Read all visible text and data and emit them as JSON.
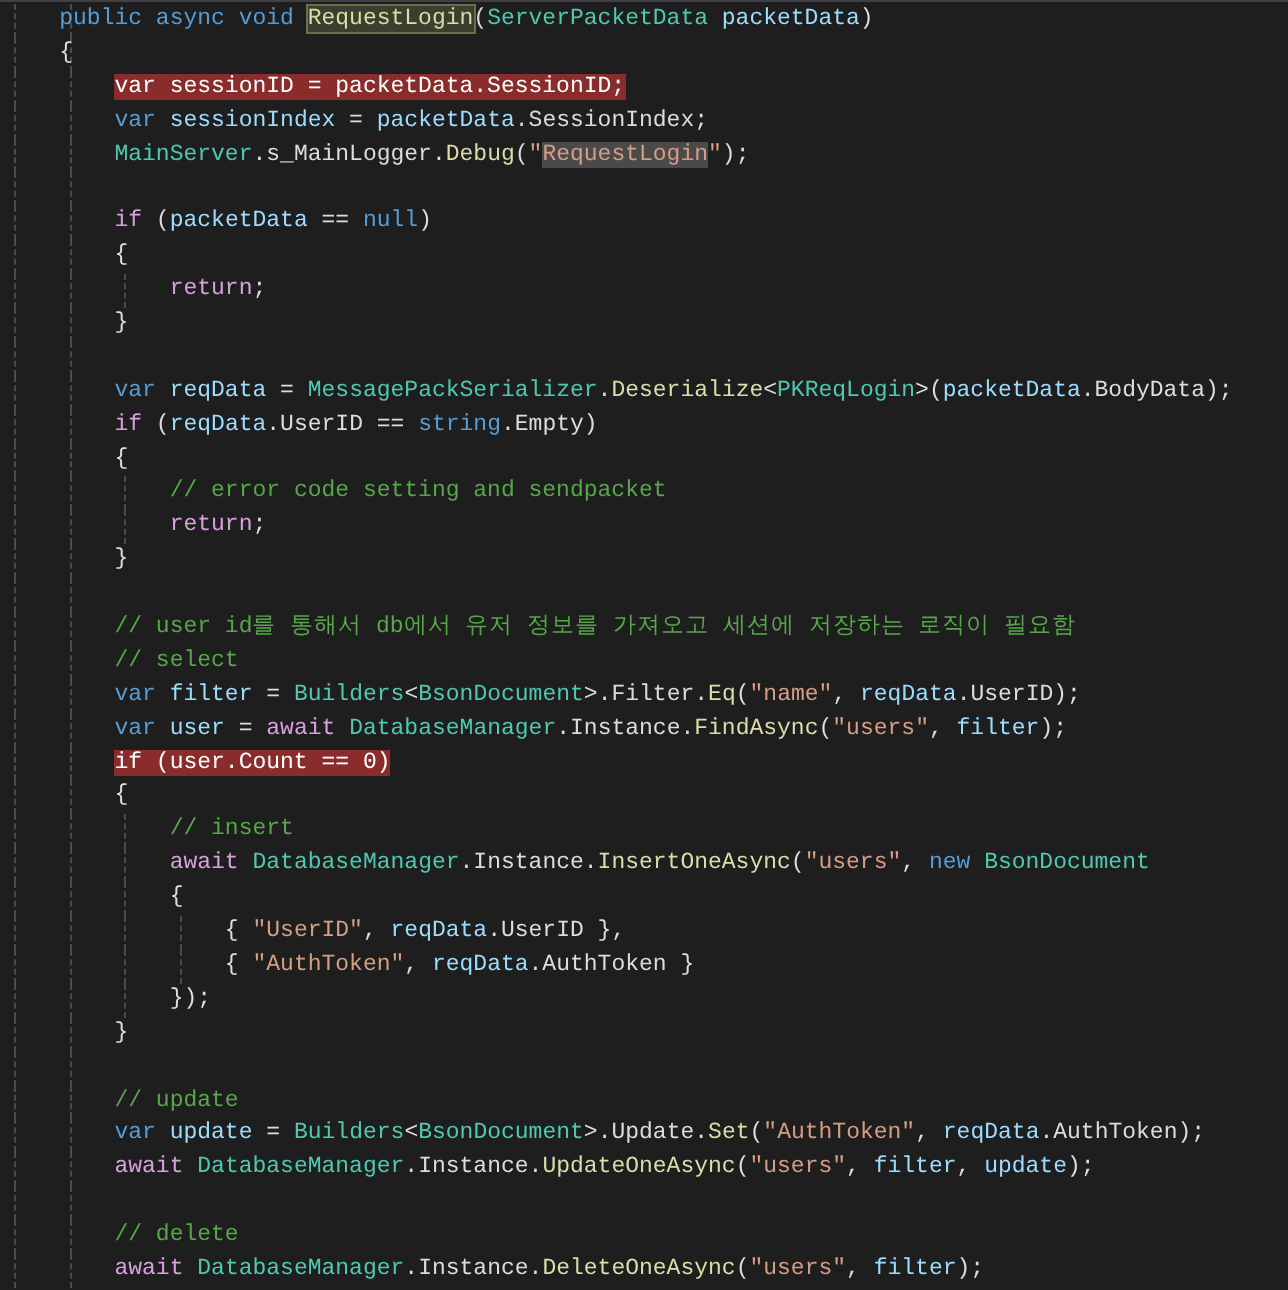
{
  "editor": {
    "lines": [
      {
        "kind": "code",
        "breakpoint": false,
        "tokens": [
          {
            "kind": "keyword",
            "text": "    public async void "
          },
          {
            "kind": "method-reference",
            "text": "RequestLogin"
          },
          {
            "kind": "plain",
            "text": "("
          },
          {
            "kind": "type",
            "text": "ServerPacketData"
          },
          {
            "kind": "variable",
            "text": " packetData"
          },
          {
            "kind": "plain",
            "text": ")"
          }
        ]
      },
      {
        "kind": "code",
        "breakpoint": false,
        "tokens": [
          {
            "kind": "plain",
            "text": "    {"
          }
        ]
      },
      {
        "kind": "code",
        "breakpoint": true,
        "tokens": [
          {
            "kind": "plain",
            "text": "        var sessionID = packetData.SessionID;"
          }
        ]
      },
      {
        "kind": "code",
        "breakpoint": false,
        "tokens": [
          {
            "kind": "keyword",
            "text": "        var "
          },
          {
            "kind": "variable",
            "text": "sessionIndex"
          },
          {
            "kind": "plain",
            "text": " = "
          },
          {
            "kind": "variable",
            "text": "packetData"
          },
          {
            "kind": "plain",
            "text": ".SessionIndex;"
          }
        ]
      },
      {
        "kind": "code",
        "breakpoint": false,
        "tokens": [
          {
            "kind": "type",
            "text": "        MainServer"
          },
          {
            "kind": "plain",
            "text": ".s_MainLogger."
          },
          {
            "kind": "method",
            "text": "Debug"
          },
          {
            "kind": "plain",
            "text": "("
          },
          {
            "kind": "string",
            "text": "\""
          },
          {
            "kind": "string-match",
            "text": "RequestLogin"
          },
          {
            "kind": "string",
            "text": "\""
          },
          {
            "kind": "plain",
            "text": ");"
          }
        ]
      },
      {
        "kind": "blank"
      },
      {
        "kind": "code",
        "breakpoint": false,
        "tokens": [
          {
            "kind": "control",
            "text": "        if"
          },
          {
            "kind": "plain",
            "text": " ("
          },
          {
            "kind": "variable",
            "text": "packetData"
          },
          {
            "kind": "plain",
            "text": " == "
          },
          {
            "kind": "keyword",
            "text": "null"
          },
          {
            "kind": "plain",
            "text": ")"
          }
        ]
      },
      {
        "kind": "code",
        "breakpoint": false,
        "tokens": [
          {
            "kind": "plain",
            "text": "        {"
          }
        ]
      },
      {
        "kind": "code",
        "breakpoint": false,
        "tokens": [
          {
            "kind": "control",
            "text": "            return"
          },
          {
            "kind": "plain",
            "text": ";"
          }
        ]
      },
      {
        "kind": "code",
        "breakpoint": false,
        "tokens": [
          {
            "kind": "plain",
            "text": "        }"
          }
        ]
      },
      {
        "kind": "blank"
      },
      {
        "kind": "code",
        "breakpoint": false,
        "tokens": [
          {
            "kind": "keyword",
            "text": "        var "
          },
          {
            "kind": "variable",
            "text": "reqData"
          },
          {
            "kind": "plain",
            "text": " = "
          },
          {
            "kind": "type",
            "text": "MessagePackSerializer"
          },
          {
            "kind": "plain",
            "text": "."
          },
          {
            "kind": "method",
            "text": "Deserialize"
          },
          {
            "kind": "plain",
            "text": "<"
          },
          {
            "kind": "type",
            "text": "PKReqLogin"
          },
          {
            "kind": "plain",
            "text": ">("
          },
          {
            "kind": "variable",
            "text": "packetData"
          },
          {
            "kind": "plain",
            "text": ".BodyData);"
          }
        ]
      },
      {
        "kind": "code",
        "breakpoint": false,
        "tokens": [
          {
            "kind": "control",
            "text": "        if"
          },
          {
            "kind": "plain",
            "text": " ("
          },
          {
            "kind": "variable",
            "text": "reqData"
          },
          {
            "kind": "plain",
            "text": ".UserID == "
          },
          {
            "kind": "keyword",
            "text": "string"
          },
          {
            "kind": "plain",
            "text": ".Empty)"
          }
        ]
      },
      {
        "kind": "code",
        "breakpoint": false,
        "tokens": [
          {
            "kind": "plain",
            "text": "        {"
          }
        ]
      },
      {
        "kind": "code",
        "breakpoint": false,
        "tokens": [
          {
            "kind": "comment",
            "text": "            // error code setting and sendpacket"
          }
        ]
      },
      {
        "kind": "code",
        "breakpoint": false,
        "tokens": [
          {
            "kind": "control",
            "text": "            return"
          },
          {
            "kind": "plain",
            "text": ";"
          }
        ]
      },
      {
        "kind": "code",
        "breakpoint": false,
        "tokens": [
          {
            "kind": "plain",
            "text": "        }"
          }
        ]
      },
      {
        "kind": "blank"
      },
      {
        "kind": "code",
        "breakpoint": false,
        "tokens": [
          {
            "kind": "comment",
            "text": "        // user id를 통해서 db에서 유저 정보를 가져오고 세션에 저장하는 로직이 필요함"
          }
        ]
      },
      {
        "kind": "code",
        "breakpoint": false,
        "tokens": [
          {
            "kind": "comment",
            "text": "        // select"
          }
        ]
      },
      {
        "kind": "code",
        "breakpoint": false,
        "tokens": [
          {
            "kind": "keyword",
            "text": "        var "
          },
          {
            "kind": "variable",
            "text": "filter"
          },
          {
            "kind": "plain",
            "text": " = "
          },
          {
            "kind": "type",
            "text": "Builders"
          },
          {
            "kind": "plain",
            "text": "<"
          },
          {
            "kind": "type",
            "text": "BsonDocument"
          },
          {
            "kind": "plain",
            "text": ">.Filter."
          },
          {
            "kind": "method",
            "text": "Eq"
          },
          {
            "kind": "plain",
            "text": "("
          },
          {
            "kind": "string",
            "text": "\"name\""
          },
          {
            "kind": "plain",
            "text": ", "
          },
          {
            "kind": "variable",
            "text": "reqData"
          },
          {
            "kind": "plain",
            "text": ".UserID);"
          }
        ]
      },
      {
        "kind": "code",
        "breakpoint": false,
        "tokens": [
          {
            "kind": "keyword",
            "text": "        var "
          },
          {
            "kind": "variable",
            "text": "user"
          },
          {
            "kind": "plain",
            "text": " = "
          },
          {
            "kind": "control",
            "text": "await "
          },
          {
            "kind": "type",
            "text": "DatabaseManager"
          },
          {
            "kind": "plain",
            "text": ".Instance."
          },
          {
            "kind": "method",
            "text": "FindAsync"
          },
          {
            "kind": "plain",
            "text": "("
          },
          {
            "kind": "string",
            "text": "\"users\""
          },
          {
            "kind": "plain",
            "text": ", "
          },
          {
            "kind": "variable",
            "text": "filter"
          },
          {
            "kind": "plain",
            "text": ");"
          }
        ]
      },
      {
        "kind": "code",
        "breakpoint": true,
        "tokens": [
          {
            "kind": "plain",
            "text": "        if (user.Count == 0)"
          }
        ]
      },
      {
        "kind": "code",
        "breakpoint": false,
        "tokens": [
          {
            "kind": "plain",
            "text": "        {"
          }
        ]
      },
      {
        "kind": "code",
        "breakpoint": false,
        "tokens": [
          {
            "kind": "comment",
            "text": "            // insert"
          }
        ]
      },
      {
        "kind": "code",
        "breakpoint": false,
        "tokens": [
          {
            "kind": "control",
            "text": "            await "
          },
          {
            "kind": "type",
            "text": "DatabaseManager"
          },
          {
            "kind": "plain",
            "text": ".Instance."
          },
          {
            "kind": "method",
            "text": "InsertOneAsync"
          },
          {
            "kind": "plain",
            "text": "("
          },
          {
            "kind": "string",
            "text": "\"users\""
          },
          {
            "kind": "plain",
            "text": ", "
          },
          {
            "kind": "keyword",
            "text": "new "
          },
          {
            "kind": "type",
            "text": "BsonDocument"
          }
        ]
      },
      {
        "kind": "code",
        "breakpoint": false,
        "tokens": [
          {
            "kind": "plain",
            "text": "            {"
          }
        ]
      },
      {
        "kind": "code",
        "breakpoint": false,
        "tokens": [
          {
            "kind": "plain",
            "text": "                { "
          },
          {
            "kind": "string",
            "text": "\"UserID\""
          },
          {
            "kind": "plain",
            "text": ", "
          },
          {
            "kind": "variable",
            "text": "reqData"
          },
          {
            "kind": "plain",
            "text": ".UserID },"
          }
        ]
      },
      {
        "kind": "code",
        "breakpoint": false,
        "tokens": [
          {
            "kind": "plain",
            "text": "                { "
          },
          {
            "kind": "string",
            "text": "\"AuthToken\""
          },
          {
            "kind": "plain",
            "text": ", "
          },
          {
            "kind": "variable",
            "text": "reqData"
          },
          {
            "kind": "plain",
            "text": ".AuthToken }"
          }
        ]
      },
      {
        "kind": "code",
        "breakpoint": false,
        "tokens": [
          {
            "kind": "plain",
            "text": "            });"
          }
        ]
      },
      {
        "kind": "code",
        "breakpoint": false,
        "tokens": [
          {
            "kind": "plain",
            "text": "        }"
          }
        ]
      },
      {
        "kind": "blank"
      },
      {
        "kind": "code",
        "breakpoint": false,
        "tokens": [
          {
            "kind": "comment",
            "text": "        // update"
          }
        ]
      },
      {
        "kind": "code",
        "breakpoint": false,
        "tokens": [
          {
            "kind": "keyword",
            "text": "        var "
          },
          {
            "kind": "variable",
            "text": "update"
          },
          {
            "kind": "plain",
            "text": " = "
          },
          {
            "kind": "type",
            "text": "Builders"
          },
          {
            "kind": "plain",
            "text": "<"
          },
          {
            "kind": "type",
            "text": "BsonDocument"
          },
          {
            "kind": "plain",
            "text": ">.Update."
          },
          {
            "kind": "method",
            "text": "Set"
          },
          {
            "kind": "plain",
            "text": "("
          },
          {
            "kind": "string",
            "text": "\"AuthToken\""
          },
          {
            "kind": "plain",
            "text": ", "
          },
          {
            "kind": "variable",
            "text": "reqData"
          },
          {
            "kind": "plain",
            "text": ".AuthToken);"
          }
        ]
      },
      {
        "kind": "code",
        "breakpoint": false,
        "tokens": [
          {
            "kind": "control",
            "text": "        await "
          },
          {
            "kind": "type",
            "text": "DatabaseManager"
          },
          {
            "kind": "plain",
            "text": ".Instance."
          },
          {
            "kind": "method",
            "text": "UpdateOneAsync"
          },
          {
            "kind": "plain",
            "text": "("
          },
          {
            "kind": "string",
            "text": "\"users\""
          },
          {
            "kind": "plain",
            "text": ", "
          },
          {
            "kind": "variable",
            "text": "filter"
          },
          {
            "kind": "plain",
            "text": ", "
          },
          {
            "kind": "variable",
            "text": "update"
          },
          {
            "kind": "plain",
            "text": ");"
          }
        ]
      },
      {
        "kind": "blank"
      },
      {
        "kind": "code",
        "breakpoint": false,
        "tokens": [
          {
            "kind": "comment",
            "text": "        // delete"
          }
        ]
      },
      {
        "kind": "code",
        "breakpoint": false,
        "tokens": [
          {
            "kind": "control",
            "text": "        await "
          },
          {
            "kind": "type",
            "text": "DatabaseManager"
          },
          {
            "kind": "plain",
            "text": ".Instance."
          },
          {
            "kind": "method",
            "text": "DeleteOneAsync"
          },
          {
            "kind": "plain",
            "text": "("
          },
          {
            "kind": "string",
            "text": "\"users\""
          },
          {
            "kind": "plain",
            "text": ", "
          },
          {
            "kind": "variable",
            "text": "filter"
          },
          {
            "kind": "plain",
            "text": ");"
          }
        ]
      }
    ]
  }
}
